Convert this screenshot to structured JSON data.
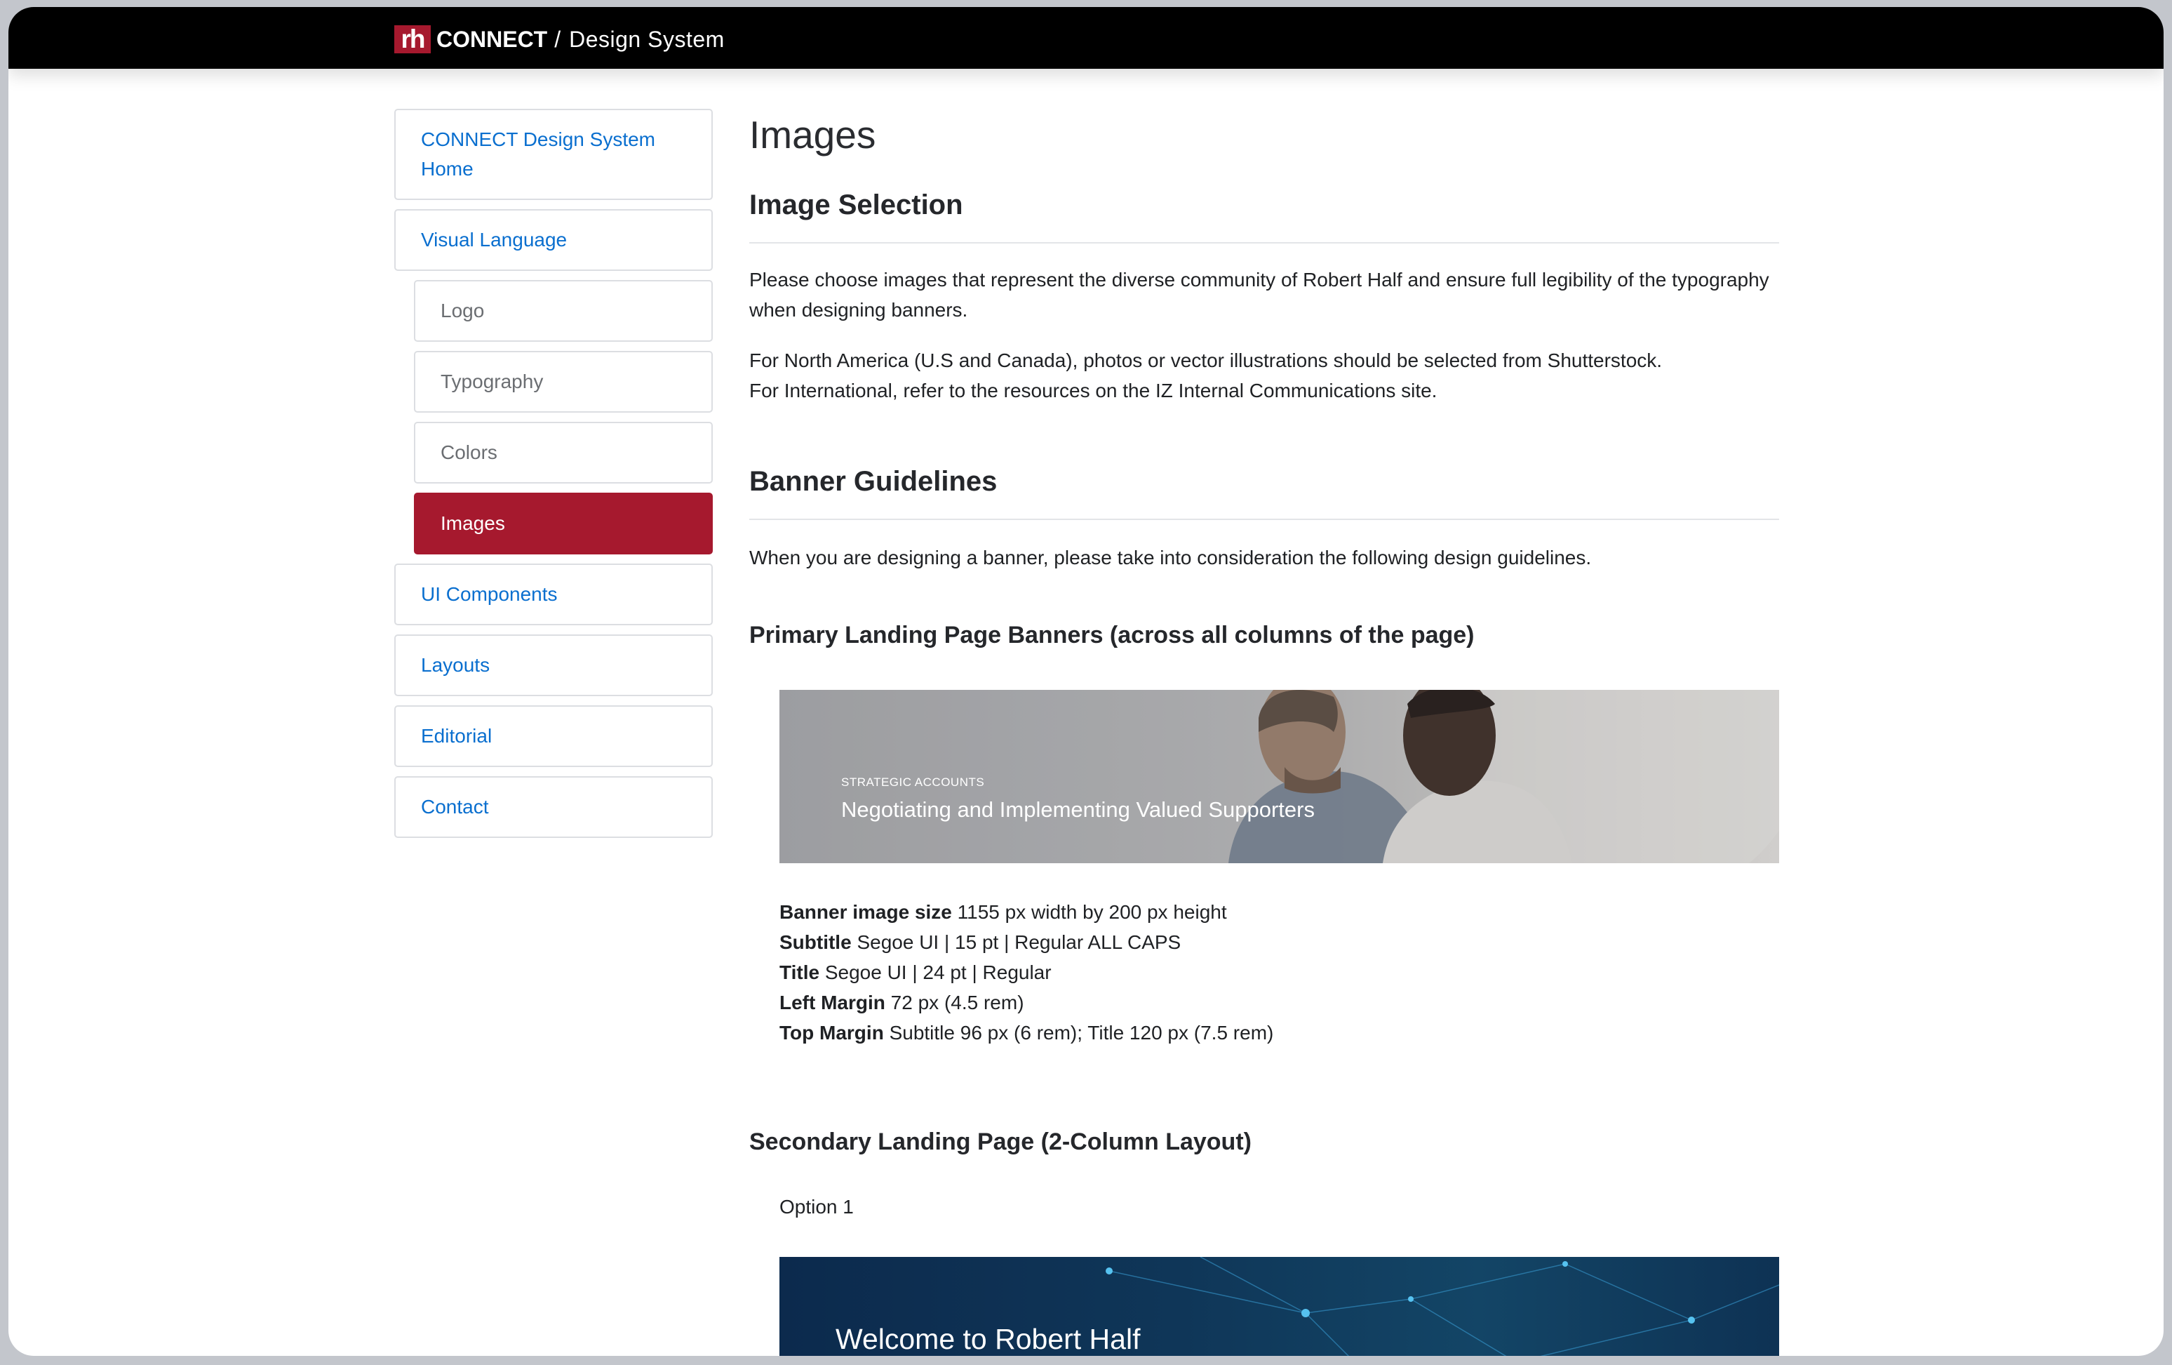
{
  "header": {
    "logo_text": "rh",
    "brand": "CONNECT",
    "separator": "/",
    "section": "Design System"
  },
  "sidebar": {
    "items": [
      {
        "label": "CONNECT Design System Home"
      },
      {
        "label": "Visual Language"
      },
      {
        "label": "Logo"
      },
      {
        "label": "Typography"
      },
      {
        "label": "Colors"
      },
      {
        "label": "Images",
        "active": true
      },
      {
        "label": "UI Components"
      },
      {
        "label": "Layouts"
      },
      {
        "label": "Editorial"
      },
      {
        "label": "Contact"
      }
    ]
  },
  "main": {
    "page_title": "Images",
    "image_selection": {
      "heading": "Image Selection",
      "para1": "Please choose images that represent the diverse community of Robert Half and ensure full legibility of the typography when designing banners.",
      "para2_line1": "For North America (U.S and Canada), photos or vector illustrations should be selected from Shutterstock.",
      "para2_line2": "For International, refer to the resources on the IZ Internal Communications site."
    },
    "banner_guidelines": {
      "heading": "Banner Guidelines",
      "intro": "When you are designing a banner, please take into consideration the following design guidelines."
    },
    "primary": {
      "heading": "Primary Landing Page Banners (across all columns of the page)",
      "banner_subtitle": "STRATEGIC ACCOUNTS",
      "banner_title": "Negotiating and Implementing Valued Supporters",
      "specs": [
        {
          "label": "Banner image size",
          "value": " 1155 px width by 200 px height"
        },
        {
          "label": "Subtitle",
          "value": " Segoe UI | 15 pt | Regular ALL CAPS"
        },
        {
          "label": "Title",
          "value": " Segoe UI | 24 pt | Regular"
        },
        {
          "label": "Left Margin",
          "value": " 72 px (4.5 rem)"
        },
        {
          "label": "Top Margin",
          "value": " Subtitle 96 px (6 rem); Title 120 px (7.5 rem)"
        }
      ]
    },
    "secondary": {
      "heading": "Secondary Landing Page (2-Column Layout)",
      "option_label": "Option 1",
      "banner_title": "Welcome to Robert Half"
    }
  },
  "colors": {
    "brand_red": "#a6192e",
    "link_blue": "#0a6fcf",
    "topbar": "#000000"
  }
}
